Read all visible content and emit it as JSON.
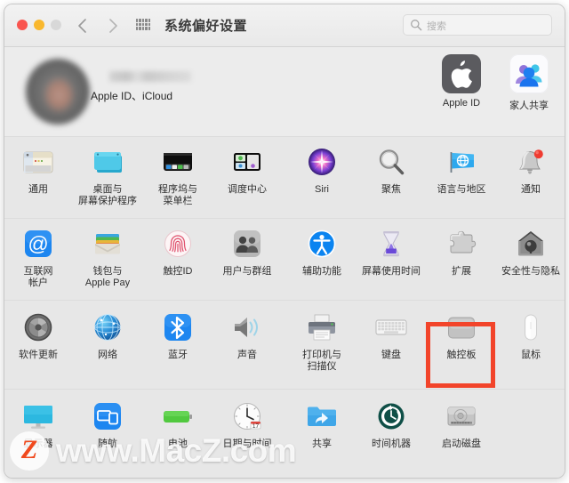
{
  "window": {
    "title": "系统偏好设置",
    "traffic_lights": [
      {
        "name": "close",
        "color": "#f9554f"
      },
      {
        "name": "minimize",
        "color": "#f9b82e"
      },
      {
        "name": "zoom",
        "color": "#d8d8d8"
      }
    ],
    "nav": {
      "back": "back-icon",
      "forward": "forward-icon"
    },
    "grid_button": "show-all-grid-icon"
  },
  "search": {
    "placeholder": "搜索",
    "value": "",
    "icon": "search-icon"
  },
  "appleid_banner": {
    "user_name": "",
    "subtitle": "Apple ID、iCloud",
    "avatar": "user-avatar",
    "tiles": [
      {
        "label": "Apple ID",
        "icon": "apple-logo-icon"
      },
      {
        "label": "家人共享",
        "icon": "family-sharing-icon"
      }
    ]
  },
  "preferences": {
    "rows": [
      {
        "items": [
          {
            "label": "通用",
            "icon": "general-icon"
          },
          {
            "label": "桌面与\n屏幕保护程序",
            "icon": "desktop-screensaver-icon"
          },
          {
            "label": "程序坞与\n菜单栏",
            "icon": "dock-menubar-icon"
          },
          {
            "label": "调度中心",
            "icon": "mission-control-icon"
          },
          {
            "label": "Siri",
            "icon": "siri-icon"
          },
          {
            "label": "聚焦",
            "icon": "spotlight-icon"
          },
          {
            "label": "语言与地区",
            "icon": "language-region-icon"
          },
          {
            "label": "通知",
            "icon": "notifications-icon"
          }
        ]
      },
      {
        "items": [
          {
            "label": "互联网\n帐户",
            "icon": "internet-accounts-icon"
          },
          {
            "label": "钱包与\nApple Pay",
            "icon": "wallet-applepay-icon"
          },
          {
            "label": "触控ID",
            "icon": "touch-id-icon"
          },
          {
            "label": "用户与群组",
            "icon": "users-groups-icon"
          },
          {
            "label": "辅助功能",
            "icon": "accessibility-icon"
          },
          {
            "label": "屏幕使用时间",
            "icon": "screen-time-icon"
          },
          {
            "label": "扩展",
            "icon": "extensions-icon"
          },
          {
            "label": "安全性与隐私",
            "icon": "security-privacy-icon"
          }
        ]
      },
      {
        "items": [
          {
            "label": "软件更新",
            "icon": "software-update-icon"
          },
          {
            "label": "网络",
            "icon": "network-icon"
          },
          {
            "label": "蓝牙",
            "icon": "bluetooth-icon"
          },
          {
            "label": "声音",
            "icon": "sound-icon"
          },
          {
            "label": "打印机与\n扫描仪",
            "icon": "printers-scanners-icon"
          },
          {
            "label": "键盘",
            "icon": "keyboard-icon"
          },
          {
            "label": "触控板",
            "icon": "trackpad-icon",
            "highlighted": true
          },
          {
            "label": "鼠标",
            "icon": "mouse-icon"
          }
        ]
      },
      {
        "items": [
          {
            "label": "显示器",
            "icon": "displays-icon"
          },
          {
            "label": "随航",
            "icon": "sidecar-icon"
          },
          {
            "label": "电池",
            "icon": "battery-icon"
          },
          {
            "label": "日期与时间",
            "icon": "date-time-icon"
          },
          {
            "label": "共享",
            "icon": "sharing-icon"
          },
          {
            "label": "时间机器",
            "icon": "time-machine-icon"
          },
          {
            "label": "启动磁盘",
            "icon": "startup-disk-icon"
          }
        ]
      }
    ]
  },
  "highlight": {
    "target_label": "触控板",
    "color": "#f2442a"
  },
  "watermark": {
    "logo_letter": "Z",
    "text": "www.MacZ.com"
  }
}
